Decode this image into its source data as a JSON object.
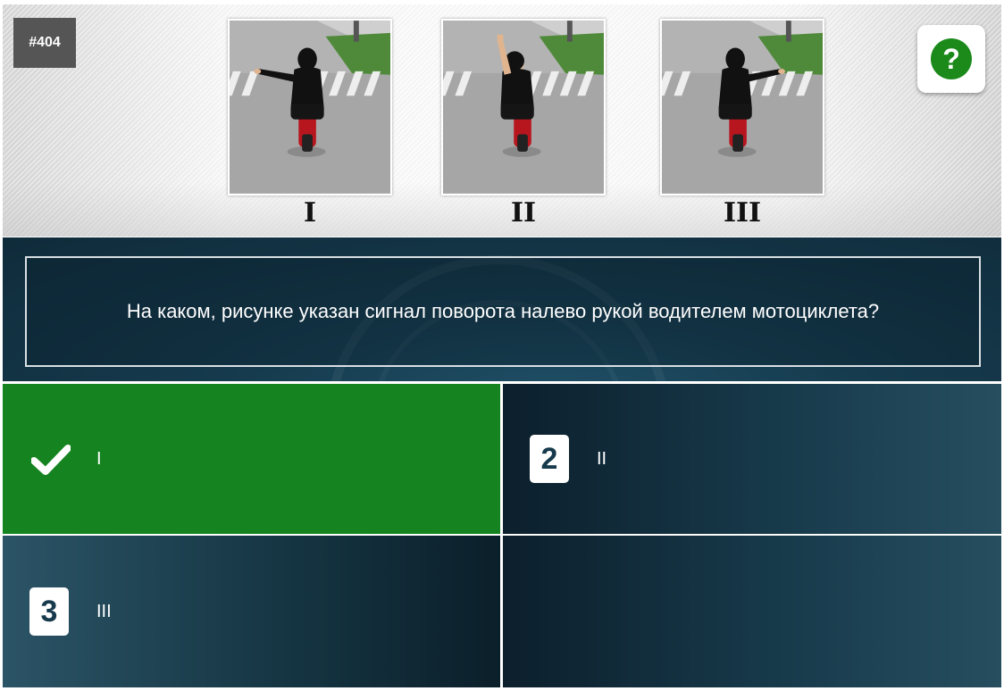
{
  "question": {
    "id": "#404",
    "text": "На каком, рисунке указан сигнал поворота налево рукой водителем мотоциклета?",
    "help_icon": "question-mark-icon",
    "figures": [
      {
        "label": "I",
        "arm": "left-horizontal"
      },
      {
        "label": "II",
        "arm": "right-raised"
      },
      {
        "label": "III",
        "arm": "right-horizontal"
      }
    ]
  },
  "answers": [
    {
      "badge": "",
      "icon": "checkmark-icon",
      "text": "I",
      "state": "correct",
      "color": "#15831f"
    },
    {
      "badge": "2",
      "text": "II"
    },
    {
      "badge": "3",
      "text": "III"
    },
    {
      "badge": "",
      "text": ""
    }
  ],
  "colors": {
    "correct_green": "#15831f",
    "dark_teal": "#163a4c",
    "help_green": "#1b8a1b",
    "badge_gray": "#555555"
  }
}
